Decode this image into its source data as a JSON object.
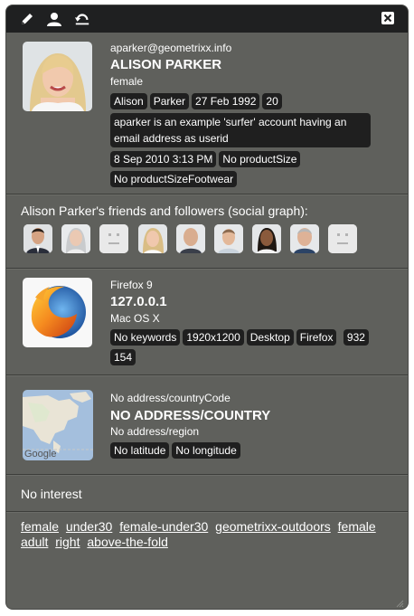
{
  "toolbar": {
    "icons": [
      "pencil-icon",
      "user-icon",
      "undo-icon",
      "close-icon"
    ]
  },
  "profile": {
    "email": "aparker@geometrixx.info",
    "name": "ALISON PARKER",
    "gender": "female",
    "chips": [
      "Alison",
      "Parker",
      "27 Feb 1992",
      "20"
    ],
    "description": "aparker is an example 'surfer' account having an email address as userid",
    "chips2": [
      "8 Sep 2010 3:13 PM",
      "No productSize"
    ],
    "chips3": [
      "No productSizeFootwear"
    ]
  },
  "social": {
    "heading": "Alison Parker's friends and followers (social graph):",
    "friends": [
      "man-dark-hair",
      "woman-gray",
      "placeholder",
      "woman-blonde",
      "man-bald",
      "man-short-hair",
      "woman-dark",
      "man-gray",
      "placeholder"
    ]
  },
  "browser": {
    "name": "Firefox 9",
    "ip": "127.0.0.1",
    "os": "Mac OS X",
    "chips": [
      "No keywords",
      "1920x1200",
      "Desktop",
      "Firefox"
    ],
    "chips2": [
      "932",
      "154"
    ]
  },
  "geo": {
    "line1": "No address/countryCode",
    "country": "NO ADDRESS/COUNTRY",
    "region": "No address/region",
    "chips": [
      "No latitude",
      "No longitude"
    ],
    "map_label": "Google"
  },
  "interest": {
    "text": "No interest"
  },
  "tags": [
    "female",
    "under30",
    "female-under30",
    "geometrixx-outdoors",
    "female",
    "adult",
    "right",
    "above-the-fold"
  ],
  "colors": {
    "panel": "#5f605c",
    "topbar": "#1f2021",
    "chip": "#1f1f1f"
  }
}
